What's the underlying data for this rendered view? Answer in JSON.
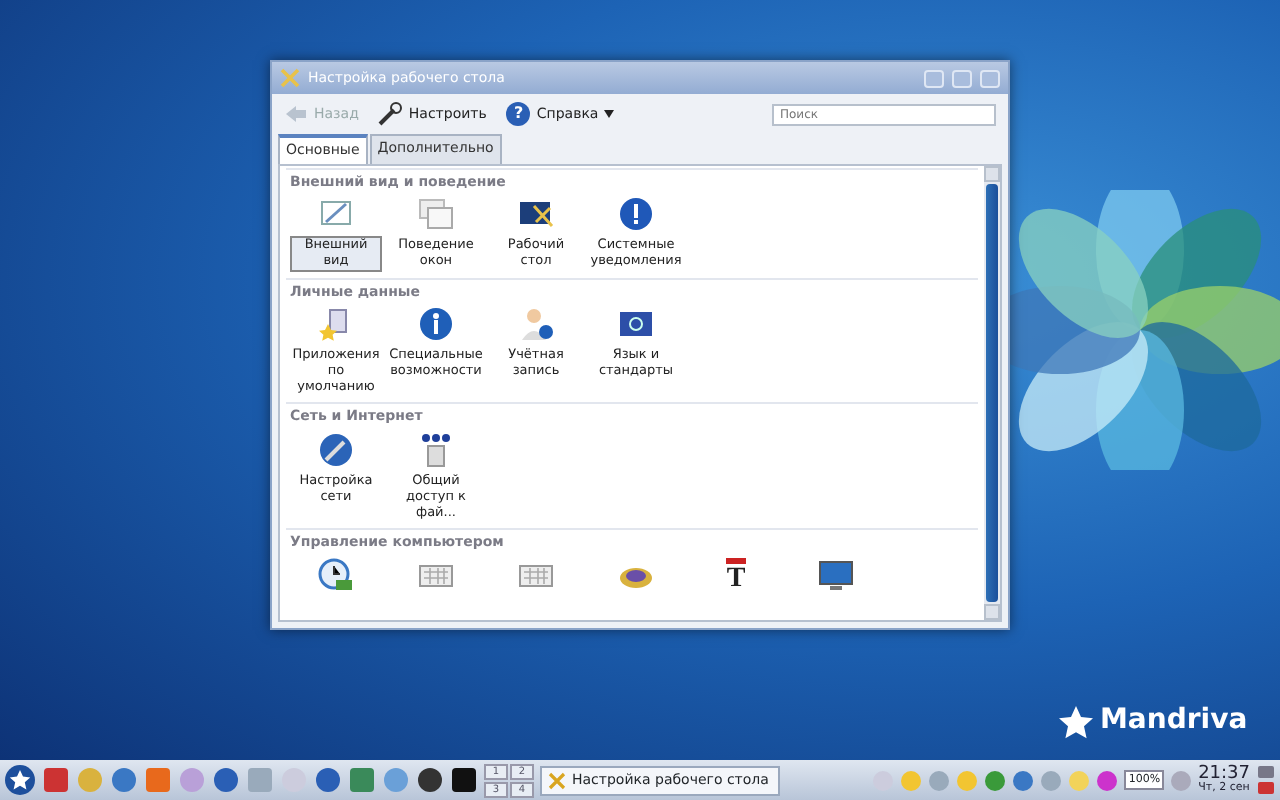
{
  "window": {
    "title": "Настройка рабочего стола"
  },
  "toolbar": [
    {
      "kind": "back",
      "label": "Назад",
      "disabled": true
    },
    {
      "kind": "configure",
      "label": "Настроить",
      "disabled": false
    },
    {
      "kind": "help",
      "glyph": "?",
      "label": "Справка",
      "disabled": false
    }
  ],
  "search": {
    "placeholder": "Поиск"
  },
  "tabs": [
    {
      "label": "Основные",
      "selected": true
    },
    {
      "label": "Дополнительно",
      "selected": false
    }
  ],
  "sections": [
    {
      "title": "Внешний вид и поведение",
      "items": [
        {
          "label": "Внешний вид",
          "selected": true
        },
        {
          "label": "Поведение окон",
          "selected": false
        },
        {
          "label": "Рабочий стол",
          "selected": false
        },
        {
          "label": "Системные уведомления",
          "selected": false
        }
      ]
    },
    {
      "title": "Личные данные",
      "items": [
        {
          "label": "Приложения по умолчанию",
          "selected": false
        },
        {
          "label": "Специальные возможности",
          "selected": false
        },
        {
          "label": "Учётная запись",
          "selected": false
        },
        {
          "label": "Язык и стандарты",
          "selected": false
        }
      ]
    },
    {
      "title": "Сеть и Интернет",
      "items": [
        {
          "label": "Настройка сети",
          "selected": false
        },
        {
          "label": "Общий доступ к фай...",
          "selected": false
        }
      ]
    },
    {
      "title": "Управление компьютером",
      "items": [
        {
          "kind": "clock"
        },
        {
          "kind": "keyboard"
        },
        {
          "kind": "keyboard"
        },
        {
          "kind": "disk"
        },
        {
          "kind": "font",
          "glyph": "T"
        },
        {
          "kind": "monitor"
        }
      ]
    }
  ],
  "taskbar": {
    "pager": [
      "1",
      "2",
      "3",
      "4"
    ],
    "task": "Настройка рабочего стола",
    "battery": "100%",
    "time": "21:37",
    "date": "Чт, 2 сен"
  },
  "logo": "Mandriva"
}
